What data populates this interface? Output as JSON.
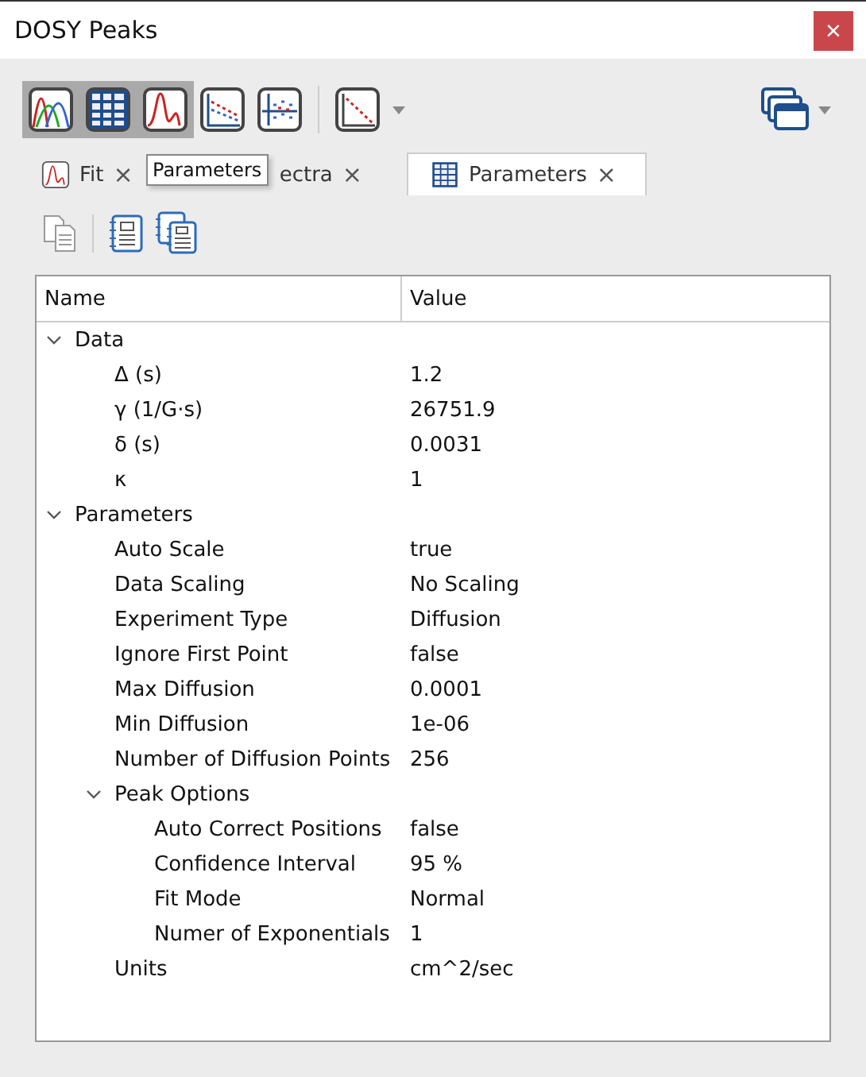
{
  "window": {
    "title": "DOSY Peaks",
    "close": "×"
  },
  "toolbar": [
    {
      "kind": "spectra",
      "selected": true
    },
    {
      "kind": "table",
      "selected": true
    },
    {
      "kind": "peak",
      "selected": true
    },
    {
      "kind": "decay",
      "selected": false
    },
    {
      "kind": "scatter",
      "selected": false
    },
    {
      "kind": "fit-line",
      "selected": false,
      "dropdown": true
    }
  ],
  "tabs": [
    {
      "kind": "plot",
      "label": "Fit",
      "close": "×",
      "selected": false
    },
    {
      "kind": "covered",
      "label": "ectra",
      "close": "×",
      "selected": false
    },
    {
      "kind": "table",
      "label": "Parameters",
      "close": "×",
      "selected": true
    }
  ],
  "tooltip": "Parameters",
  "table": {
    "columns": [
      "Name",
      "Value"
    ],
    "rows": [
      {
        "name": "Data",
        "expanded": true,
        "children": [
          {
            "name": "Δ (s)",
            "value": "1.2"
          },
          {
            "name": "γ (1/G·s)",
            "value": "26751.9"
          },
          {
            "name": "δ (s)",
            "value": "0.0031"
          },
          {
            "name": "κ",
            "value": "1"
          }
        ]
      },
      {
        "name": "Parameters",
        "expanded": true,
        "children": [
          {
            "name": "Auto Scale",
            "value": "true"
          },
          {
            "name": "Data Scaling",
            "value": "No Scaling"
          },
          {
            "name": "Experiment Type",
            "value": "Diffusion"
          },
          {
            "name": "Ignore First Point",
            "value": "false"
          },
          {
            "name": "Max Diffusion",
            "value": "0.0001"
          },
          {
            "name": "Min Diffusion",
            "value": "1e-06"
          },
          {
            "name": "Number of Diffusion Points",
            "value": "256"
          },
          {
            "name": "Peak Options",
            "expanded": true,
            "children": [
              {
                "name": "Auto Correct Positions",
                "value": "false"
              },
              {
                "name": "Confidence Interval",
                "value": "95 %"
              },
              {
                "name": "Fit Mode",
                "value": "Normal"
              },
              {
                "name": "Numer of Exponentials",
                "value": "1"
              }
            ]
          },
          {
            "name": "Units",
            "value": "cm^2/sec"
          }
        ]
      }
    ]
  }
}
